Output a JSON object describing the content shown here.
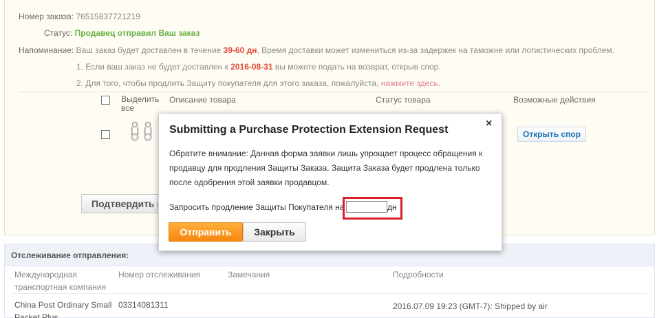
{
  "order": {
    "number_label": "Номер заказа:",
    "number_value": "76515837721219",
    "status_label": "Статус:",
    "status_value": "Продавец отправил Ваш заказ",
    "reminder_label": "Напоминание:",
    "reminder_pre": "Ваш заказ будет доставлен в течение",
    "reminder_days": "39-60 дн",
    "reminder_post": ", Время доставки может измениться из-за задержек на таможне или логистических проблем.",
    "note1_pre": "1. Если ваш заказ не будет доставлен к",
    "note1_date": "2016-08-31",
    "note1_post": "вы можете подать на возврат, открыв спор.",
    "note2_pre": "2. Для того, чтобы продлить Защиту покупателя для этого заказа, пожалуйста,",
    "note2_link": "нажмите здесь",
    "note2_post": "."
  },
  "products_table": {
    "select_all": "Выделить",
    "select_all_2": "все",
    "col_description": "Описание товара",
    "col_status": "Статус товара",
    "col_actions": "Возможные действия",
    "open_dispute_button": "Открыть спор",
    "confirm_button": "Подтвердить п"
  },
  "tracking": {
    "header": "Отслеживание отправления:",
    "col_company": "Международная",
    "col_company_2": "транспортная компания",
    "col_tracking_number": "Номер отслеживания",
    "col_remarks": "Замечания",
    "col_details": "Подробности",
    "row_company": "China Post Ordinary Small",
    "row_company_2": "Packet Plus",
    "row_tracking_number": "03314081311",
    "row_details": "2016.07.09 19:23 (GMT-7): Shipped by air"
  },
  "modal": {
    "title": "Submitting a Purchase Protection Extension Request",
    "close_symbol": "×",
    "notice": "Обратите внимание: Данная форма заявки лишь упрощает процесс обращения к продавцу для продления Защиты Заказа. Защита Заказа будет продлена только после одобрения этой заявки продавцом.",
    "extension_label": "Запросить продление Защиты Покупателя на",
    "extension_value": "",
    "extension_unit": "дн",
    "submit_button": "Отправить",
    "close_button": "Закрыть"
  },
  "colors": {
    "status_green": "#68b045",
    "accent_red": "#e04b3c",
    "link_pink": "#e37e99",
    "submit_orange": "#f7860e",
    "highlight_red": "#d9202b"
  }
}
